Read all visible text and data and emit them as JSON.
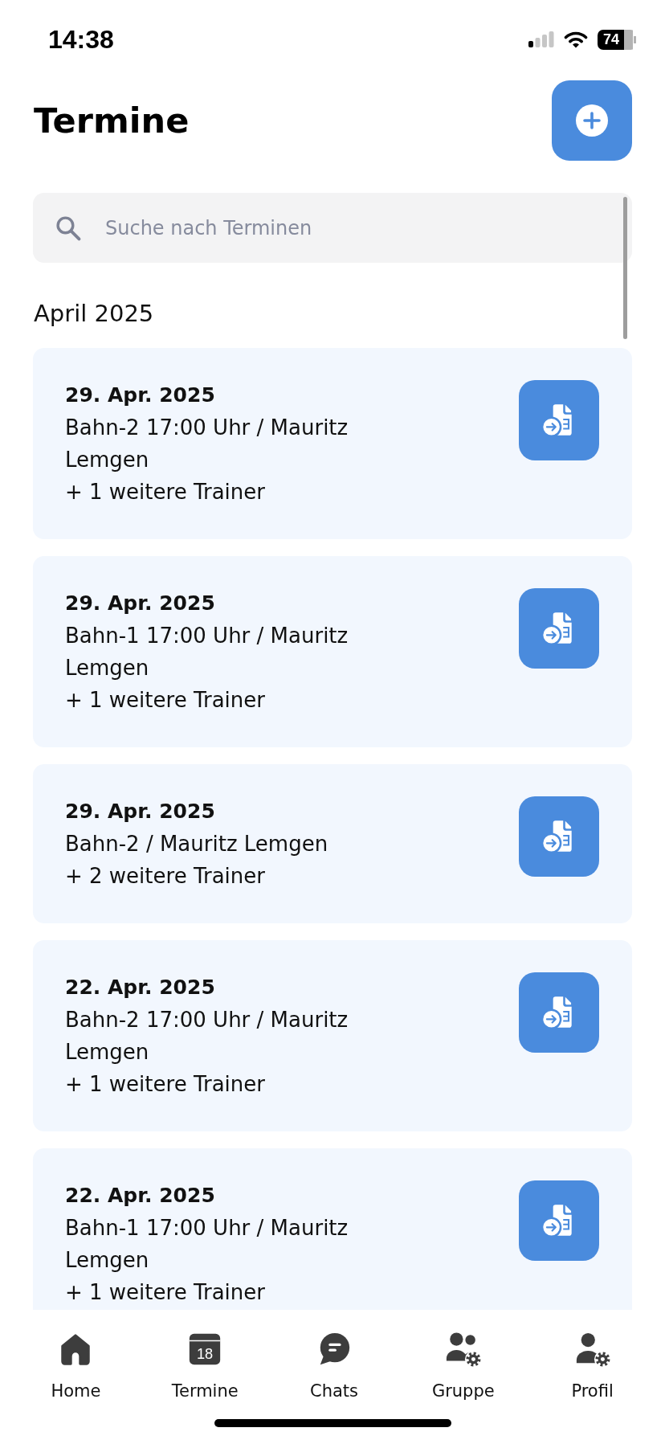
{
  "status_bar": {
    "time": "14:38",
    "battery": "74"
  },
  "header": {
    "title": "Termine"
  },
  "search": {
    "placeholder": "Suche nach Terminen"
  },
  "month_label": "April 2025",
  "appointments": [
    {
      "date": "29. Apr. 2025",
      "details": "Bahn-2 17:00 Uhr / Mauritz Lemgen",
      "trainers": "+ 1 weitere Trainer"
    },
    {
      "date": "29. Apr. 2025",
      "details": "Bahn-1 17:00 Uhr / Mauritz Lemgen",
      "trainers": "+ 1 weitere Trainer"
    },
    {
      "date": "29. Apr. 2025",
      "details": "Bahn-2 / Mauritz Lemgen",
      "trainers": "+ 2 weitere Trainer"
    },
    {
      "date": "22. Apr. 2025",
      "details": "Bahn-2 17:00 Uhr / Mauritz Lemgen",
      "trainers": "+ 1 weitere Trainer"
    },
    {
      "date": "22. Apr. 2025",
      "details": "Bahn-1 17:00 Uhr / Mauritz Lemgen",
      "trainers": "+ 1 weitere Trainer"
    }
  ],
  "tab_bar": {
    "items": [
      {
        "label": "Home"
      },
      {
        "label": "Termine",
        "calendar_day": "18"
      },
      {
        "label": "Chats"
      },
      {
        "label": "Gruppe"
      },
      {
        "label": "Profil"
      }
    ]
  }
}
